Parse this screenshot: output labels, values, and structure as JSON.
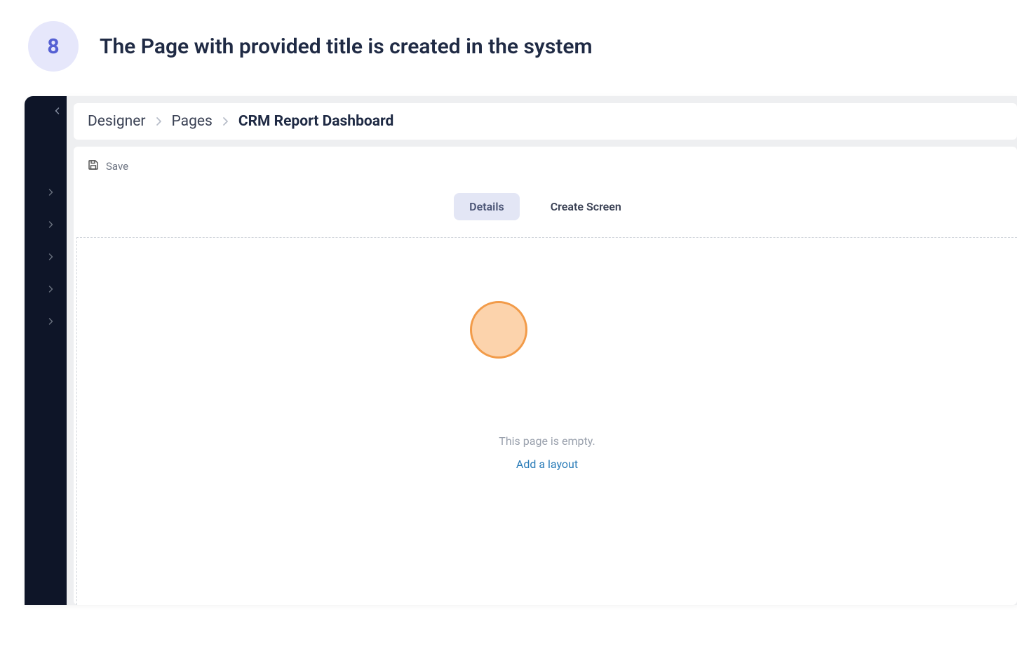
{
  "step": {
    "number": "8",
    "title": "The Page with provided title is created in the system"
  },
  "breadcrumb": {
    "items": [
      "Designer",
      "Pages"
    ],
    "current": "CRM Report Dashboard"
  },
  "toolbar": {
    "save_label": "Save"
  },
  "tabs": [
    {
      "label": "Details",
      "active": true
    },
    {
      "label": "Create Screen",
      "active": false
    }
  ],
  "canvas": {
    "empty_message": "This page is empty.",
    "add_layout_label": "Add a layout"
  }
}
